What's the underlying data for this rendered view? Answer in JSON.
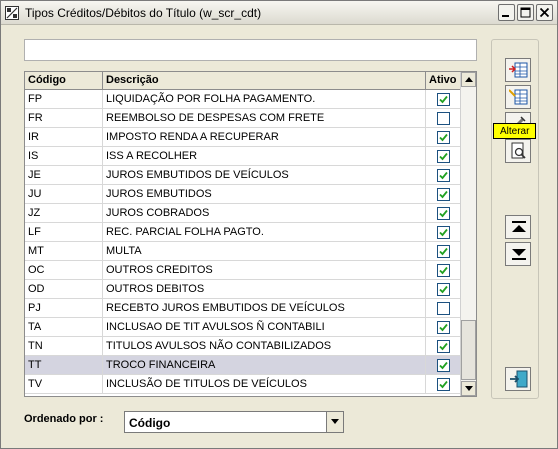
{
  "window": {
    "title": "Tipos Créditos/Débitos do Título (w_scr_cdt)"
  },
  "filter": {
    "value": ""
  },
  "grid": {
    "headers": {
      "code": "Código",
      "description": "Descrição",
      "active": "Ativo"
    },
    "rows": [
      {
        "code": "FP",
        "description": "LIQUIDAÇÃO POR FOLHA PAGAMENTO.",
        "active": true
      },
      {
        "code": "FR",
        "description": "REEMBOLSO DE DESPESAS COM FRETE",
        "active": false
      },
      {
        "code": "IR",
        "description": "IMPOSTO RENDA A RECUPERAR",
        "active": true
      },
      {
        "code": "IS",
        "description": "ISS A RECOLHER",
        "active": true
      },
      {
        "code": "JE",
        "description": "JUROS EMBUTIDOS DE VEÍCULOS",
        "active": true
      },
      {
        "code": "JU",
        "description": "JUROS EMBUTIDOS",
        "active": true
      },
      {
        "code": "JZ",
        "description": "JUROS COBRADOS",
        "active": true
      },
      {
        "code": "LF",
        "description": "REC. PARCIAL FOLHA PAGTO.",
        "active": true
      },
      {
        "code": "MT",
        "description": "MULTA",
        "active": true
      },
      {
        "code": "OC",
        "description": "OUTROS CREDITOS",
        "active": true
      },
      {
        "code": "OD",
        "description": "OUTROS DEBITOS",
        "active": true
      },
      {
        "code": "PJ",
        "description": "RECEBTO JUROS EMBUTIDOS DE VEÍCULOS",
        "active": false
      },
      {
        "code": "TA",
        "description": "INCLUSAO DE TIT AVULSOS Ñ CONTABILI",
        "active": true
      },
      {
        "code": "TN",
        "description": "TITULOS AVULSOS NÃO CONTABILIZADOS",
        "active": true
      },
      {
        "code": "TT",
        "description": "TROCO FINANCEIRA",
        "active": true,
        "selected": true
      },
      {
        "code": "TV",
        "description": "INCLUSÃO DE TITULOS DE VEÍCULOS",
        "active": true
      }
    ]
  },
  "toolbar": {
    "tooltip": "Alterar",
    "icons": [
      "insert-row-icon",
      "edit-row-icon",
      "delete-icon",
      "search-icon",
      "scroll-up-icon",
      "scroll-down-icon",
      "exit-icon"
    ]
  },
  "order": {
    "label": "Ordenado por :",
    "value": "Código"
  },
  "colors": {
    "selected_row": "#d4d4e0",
    "check": "#21a121",
    "tooltip_bg": "#ffff00"
  }
}
